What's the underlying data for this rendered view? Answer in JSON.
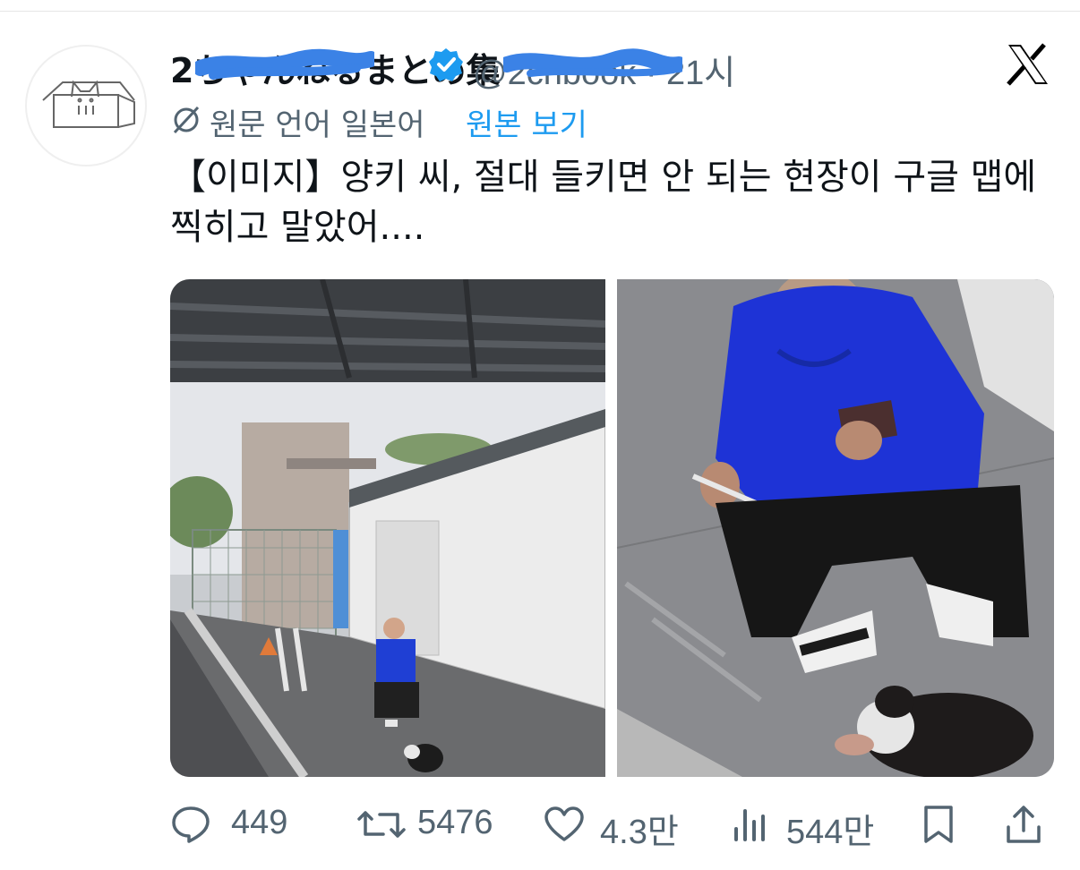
{
  "tweet": {
    "display_name": "2ちゃんねるまとめ集",
    "handle": "@2chbook",
    "time": "· 21시",
    "translate": {
      "label": "원문 언어 일본어",
      "link": "원본 보기"
    },
    "text_line1": "【이미지】양키 씨, 절대 들키면 안 되는 현장이 구글 맵에",
    "text_line2": "찍히고 말았어...."
  },
  "actions": {
    "reply_count": "449",
    "retweet_count": "5476",
    "like_count": "4.3만",
    "view_count": "544만"
  },
  "icons": {
    "avatar": "cat-in-box-icon",
    "verified": "verified-badge-icon",
    "x": "x-logo-icon",
    "translate": "globe-slash-icon",
    "reply": "reply-icon",
    "retweet": "retweet-icon",
    "like": "heart-icon",
    "views": "views-icon",
    "bookmark": "bookmark-icon",
    "share": "share-icon"
  },
  "colors": {
    "verified": "#1d9bf0",
    "link": "#1d9bf0",
    "muted": "#536471",
    "text": "#0f1419",
    "redaction": "#3b82e6"
  }
}
